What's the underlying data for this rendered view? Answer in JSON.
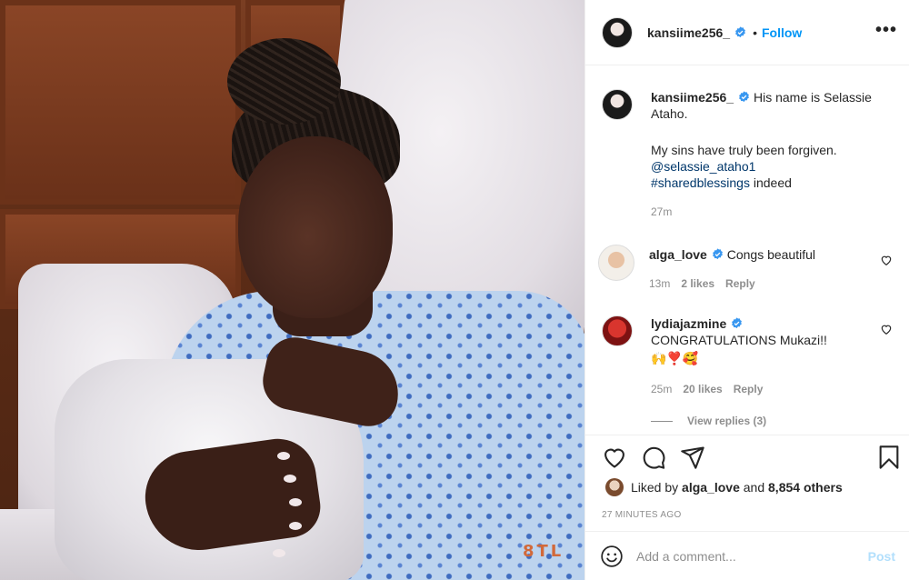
{
  "header": {
    "username": "kansiime256_",
    "follow_label": "Follow",
    "separator": "•",
    "more_label": "•••"
  },
  "caption": {
    "username": "kansiime256_",
    "line1": "His name is Selassie Ataho.",
    "line2": "My sins have truly been forgiven.",
    "mention": "@selassie_ataho1",
    "hashtag": "#sharedblessings",
    "hashtag_suffix": " indeed",
    "time": "27m"
  },
  "comments": [
    {
      "username": "alga_love",
      "text": "Congs beautiful",
      "time": "13m",
      "likes": "2 likes",
      "reply_label": "Reply"
    },
    {
      "username": "lydiajazmine",
      "text": "CONGRATULATIONS Mukazi!!",
      "emoji": "🙌❣️🥰",
      "time": "25m",
      "likes": "20 likes",
      "reply_label": "Reply"
    }
  ],
  "view_replies": "View replies (3)",
  "likes": {
    "prefix": "Liked by ",
    "user": "alga_love",
    "middle": " and ",
    "others": "8,854 others"
  },
  "timestamp": "27 MINUTES AGO",
  "add_comment": {
    "placeholder": "Add a comment...",
    "post_label": "Post"
  },
  "photo": {
    "watermark": "8TL"
  },
  "colors": {
    "link": "#0095f6",
    "post_disabled": "#b2dffc",
    "secondary_text": "#8e8e8e"
  },
  "icons": [
    "verified-badge-icon",
    "more-icon",
    "heart-icon",
    "comment-icon",
    "share-icon",
    "bookmark-icon",
    "emoji-icon"
  ]
}
